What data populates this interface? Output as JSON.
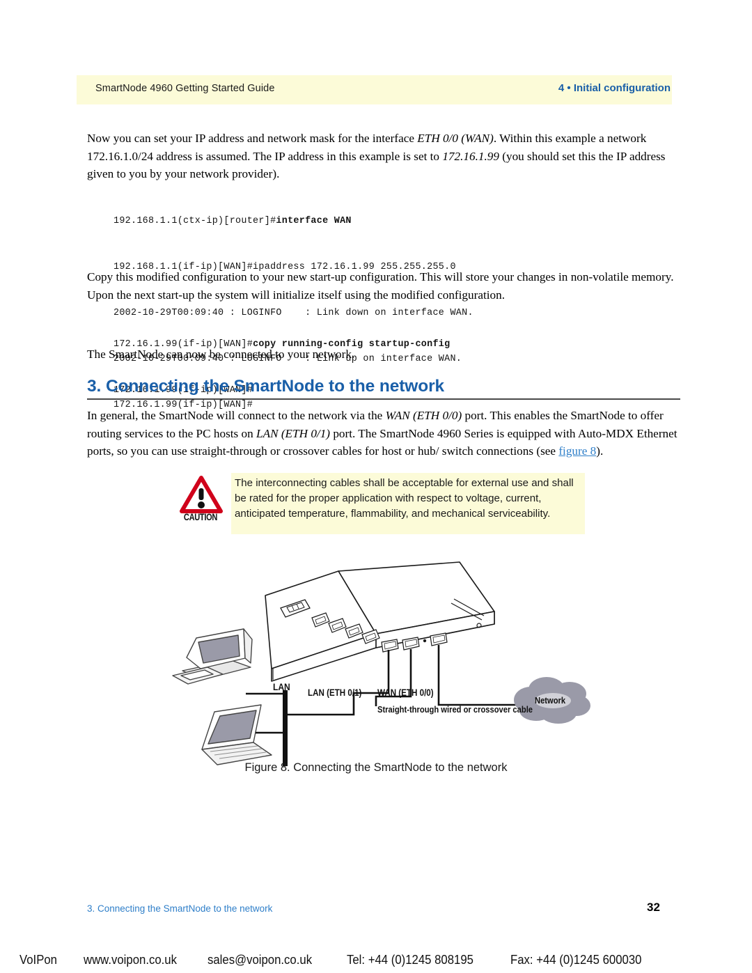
{
  "header": {
    "left_title": "SmartNode 4960 Getting Started Guide",
    "right_title": "4 • Initial configuration",
    "band_color": "#fcfbd8",
    "accent_color": "#1a5fa8"
  },
  "body": {
    "paragraph_1_part1": "Now you can set your IP address and network mask for the interface ",
    "paragraph_1_em1": "ETH 0/0 (WAN)",
    "paragraph_1_part2": ". Within this example a network 172.16.1.0/24 address is assumed. The IP address in this example is set to ",
    "paragraph_1_em2": "172.16.1.99",
    "paragraph_1_part3": " (you should set this the IP address given to you by your network provider).",
    "paragraph_2": "Copy this modified configuration to your new start-up configuration. This will store your changes in non-volatile memory. Upon the next start-up the system will initialize itself using the modified configuration.",
    "paragraph_3": "The SmartNode can now be connected to your network.",
    "paragraph_4_part1": "In general, the SmartNode will connect to the network via the ",
    "paragraph_4_em1": "WAN (ETH 0/0)",
    "paragraph_4_part2": " port. This enables the SmartNode to offer routing services to the PC hosts on ",
    "paragraph_4_em2": "LAN (ETH 0/1)",
    "paragraph_4_part3": " port. The SmartNode 4960 Series is equipped with Auto-MDX Ethernet ports, so you can use straight-through or crossover cables for host or hub/ switch connections (see ",
    "paragraph_4_link": "figure 8",
    "paragraph_4_part4": ")."
  },
  "code_block_1": {
    "line1_prompt": "192.168.1.1(ctx-ip)[router]#",
    "line1_cmd": "interface WAN",
    "line2": "192.168.1.1(if-ip)[WAN]#ipaddress 172.16.1.99 255.255.255.0",
    "line3": "2002-10-29T00:09:40 : LOGINFO    : Link down on interface WAN.",
    "line4": "2002-10-29T00:09:40 : LOGINFO    : Link up on interface WAN.",
    "line5": "172.16.1.99(if-ip)[WAN]#"
  },
  "code_block_2": {
    "line1_prompt": "172.16.1.99(if-ip)[WAN]#",
    "line1_cmd": "copy running-config startup-config",
    "line2": "172.16.1.99(if-ip)[WAN]#"
  },
  "section": {
    "heading": "3. Connecting the SmartNode to the network"
  },
  "caution": {
    "label": "CAUTION",
    "icon": "warning-triangle-icon",
    "triangle_color": "#d0021b",
    "panel_color": "#fcfbd8",
    "text": "The interconnecting cables shall be acceptable for external use and shall be rated for the proper application with respect to voltage, current, anticipated temperature, flammability, and mechanical serviceability."
  },
  "figure": {
    "caption": "Figure 8. Connecting the SmartNode to the network",
    "lan_bus_label": "LAN",
    "lan_port_label": "LAN (ETH 0/1)",
    "wan_port_label": "WAN (ETH 0/0)",
    "cable_label": "Straight-through wired or crossover cable",
    "cloud_label": "Network",
    "cloud_color": "#9a9aa8"
  },
  "footer": {
    "section_ref": "3. Connecting the SmartNode to the network",
    "page_number": "32",
    "link_color": "#2f7fc9"
  },
  "voipon_bar": {
    "brand": "VoIPon",
    "website": "www.voipon.co.uk",
    "email": "sales@voipon.co.uk",
    "telephone": "Tel: +44 (0)1245 808195",
    "fax": "Fax: +44 (0)1245 600030"
  }
}
